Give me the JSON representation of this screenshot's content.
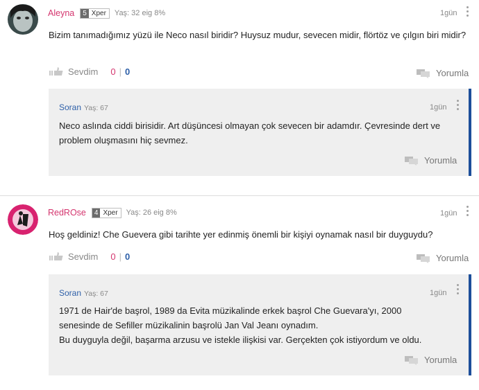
{
  "comments": [
    {
      "username": "Aleyna",
      "level": "5",
      "rank": "Xper",
      "meta": "Yaş: 32 eig 8%",
      "time": "1gün",
      "text": "Bizim tanımadığımız yüzü ile Neco nasıl biridir? Huysuz mudur, sevecen midir, flörtöz ve çılgın biri midir?",
      "like_label": "Sevdim",
      "likes": "0",
      "dislikes": "0",
      "reply_label": "Yorumla",
      "reply": {
        "username": "Soran",
        "meta": "Yaş: 67",
        "time": "1gün",
        "text": "Neco aslında ciddi birisidir. Art düşüncesi olmayan çok sevecen bir adamdır. Çevresinde dert ve problem oluşmasını hiç sevmez.",
        "reply_label": "Yorumla"
      }
    },
    {
      "username": "RedROse",
      "level": "4",
      "rank": "Xper",
      "meta": "Yaş: 26 eig 8%",
      "time": "1gün",
      "text": "Hoş geldiniz! Che Guevera gibi tarihte yer edinmiş önemli bir kişiyi oynamak nasıl bir duyguydu?",
      "like_label": "Sevdim",
      "likes": "0",
      "dislikes": "0",
      "reply_label": "Yorumla",
      "reply": {
        "username": "Soran",
        "meta": "Yaş: 67",
        "time": "1gün",
        "text_lines": [
          "1971 de Hair'de başrol, 1989 da Evita müzikalinde erkek başrol Che Guevara'yı, 2000",
          "senesinde de Sefiller müzikalinin başrolü Jan Val Jeanı oynadım.",
          "Bu duyguyla değil, başarma arzusu ve istekle ilişkisi var. Gerçekten çok istiyordum ve oldu."
        ],
        "reply_label": "Yorumla"
      }
    }
  ],
  "colors": {
    "username": "#d4356e",
    "reply_user": "#2d5fa8",
    "reply_bg": "#efefef",
    "reply_border": "#1d4f9a"
  }
}
